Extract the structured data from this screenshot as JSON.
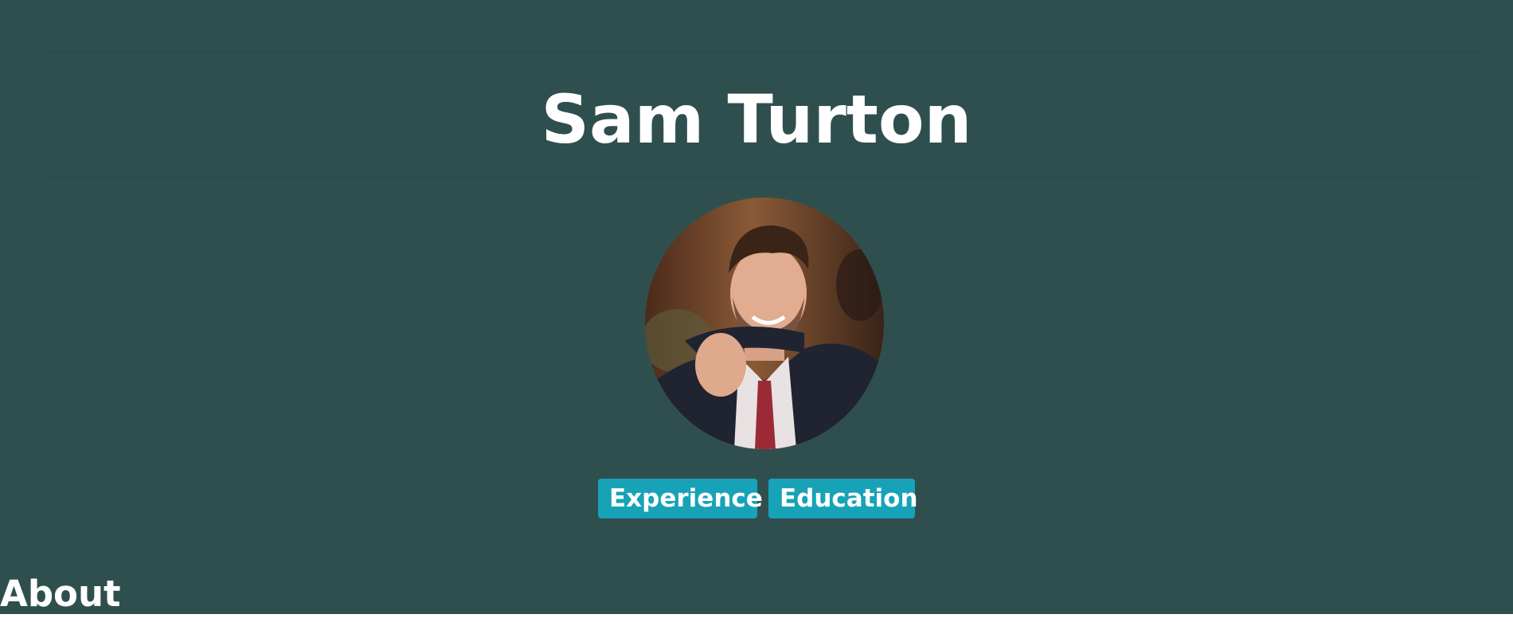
{
  "header": {
    "name": "Sam Turton"
  },
  "profile": {
    "avatar_alt": "profile photo"
  },
  "nav": {
    "experience_label": "Experience",
    "education_label": "Education"
  },
  "sections": {
    "about_heading": "About"
  },
  "colors": {
    "background": "#2f4f4f",
    "button": "#17a2b8",
    "text": "#ffffff"
  }
}
